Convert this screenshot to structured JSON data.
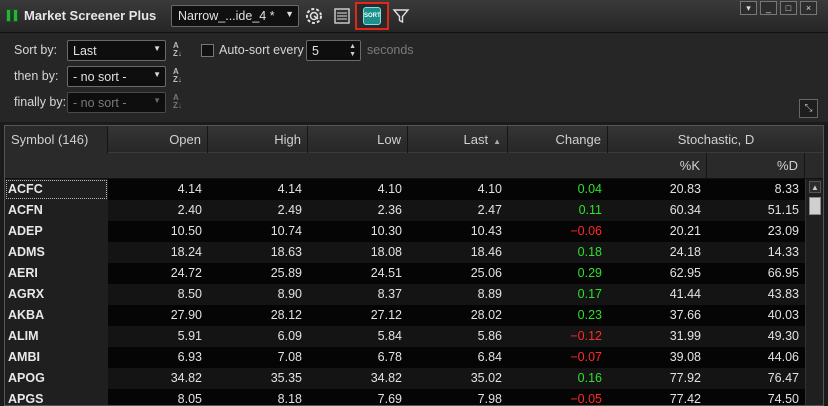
{
  "window": {
    "title": "Market Screener Plus",
    "layout_name": "Narrow_...ide_4 *",
    "controls": {
      "minimize": "_",
      "maximize": "□",
      "close": "×"
    }
  },
  "toolbar": {
    "icons": [
      "layout-dropdown-arrow",
      "settings-gear-icon",
      "list-icon",
      "sort-icon",
      "filter-icon"
    ],
    "sort_button_text": "SORT",
    "highlight_color": "#e0281c"
  },
  "sort_panel": {
    "sort_by_label": "Sort by:",
    "sort_by_value": "Last",
    "then_by_label": "then by:",
    "then_by_value": "- no sort -",
    "finally_by_label": "finally by:",
    "finally_by_value": "- no sort -",
    "autosort_label": "Auto-sort every",
    "autosort_value": "5",
    "seconds_label": "seconds"
  },
  "grid": {
    "headers": {
      "symbol": "Symbol (146)",
      "open": "Open",
      "high": "High",
      "low": "Low",
      "last": "Last",
      "change": "Change",
      "stochastic": "Stochastic, D",
      "k": "%K",
      "d": "%D"
    },
    "rows": [
      {
        "symbol": "ACFC",
        "open": "4.14",
        "high": "4.14",
        "low": "4.10",
        "last": "4.10",
        "change": "0.04",
        "k": "20.83",
        "d": "8.33"
      },
      {
        "symbol": "ACFN",
        "open": "2.40",
        "high": "2.49",
        "low": "2.36",
        "last": "2.47",
        "change": "0.11",
        "k": "60.34",
        "d": "51.15"
      },
      {
        "symbol": "ADEP",
        "open": "10.50",
        "high": "10.74",
        "low": "10.30",
        "last": "10.43",
        "change": "−0.06",
        "k": "20.21",
        "d": "23.09"
      },
      {
        "symbol": "ADMS",
        "open": "18.24",
        "high": "18.63",
        "low": "18.08",
        "last": "18.46",
        "change": "0.18",
        "k": "24.18",
        "d": "14.33"
      },
      {
        "symbol": "AERI",
        "open": "24.72",
        "high": "25.89",
        "low": "24.51",
        "last": "25.06",
        "change": "0.29",
        "k": "62.95",
        "d": "66.95"
      },
      {
        "symbol": "AGRX",
        "open": "8.50",
        "high": "8.90",
        "low": "8.37",
        "last": "8.89",
        "change": "0.17",
        "k": "41.44",
        "d": "43.83"
      },
      {
        "symbol": "AKBA",
        "open": "27.90",
        "high": "28.12",
        "low": "27.12",
        "last": "28.02",
        "change": "0.23",
        "k": "37.66",
        "d": "40.03"
      },
      {
        "symbol": "ALIM",
        "open": "5.91",
        "high": "6.09",
        "low": "5.84",
        "last": "5.86",
        "change": "−0.12",
        "k": "31.99",
        "d": "49.30"
      },
      {
        "symbol": "AMBI",
        "open": "6.93",
        "high": "7.08",
        "low": "6.78",
        "last": "6.84",
        "change": "−0.07",
        "k": "39.08",
        "d": "44.06"
      },
      {
        "symbol": "APOG",
        "open": "34.82",
        "high": "35.35",
        "low": "34.82",
        "last": "35.02",
        "change": "0.16",
        "k": "77.92",
        "d": "76.47"
      },
      {
        "symbol": "APGS",
        "open": "8.05",
        "high": "8.18",
        "low": "7.69",
        "last": "7.98",
        "change": "−0.05",
        "k": "77.42",
        "d": "74.50"
      }
    ]
  }
}
